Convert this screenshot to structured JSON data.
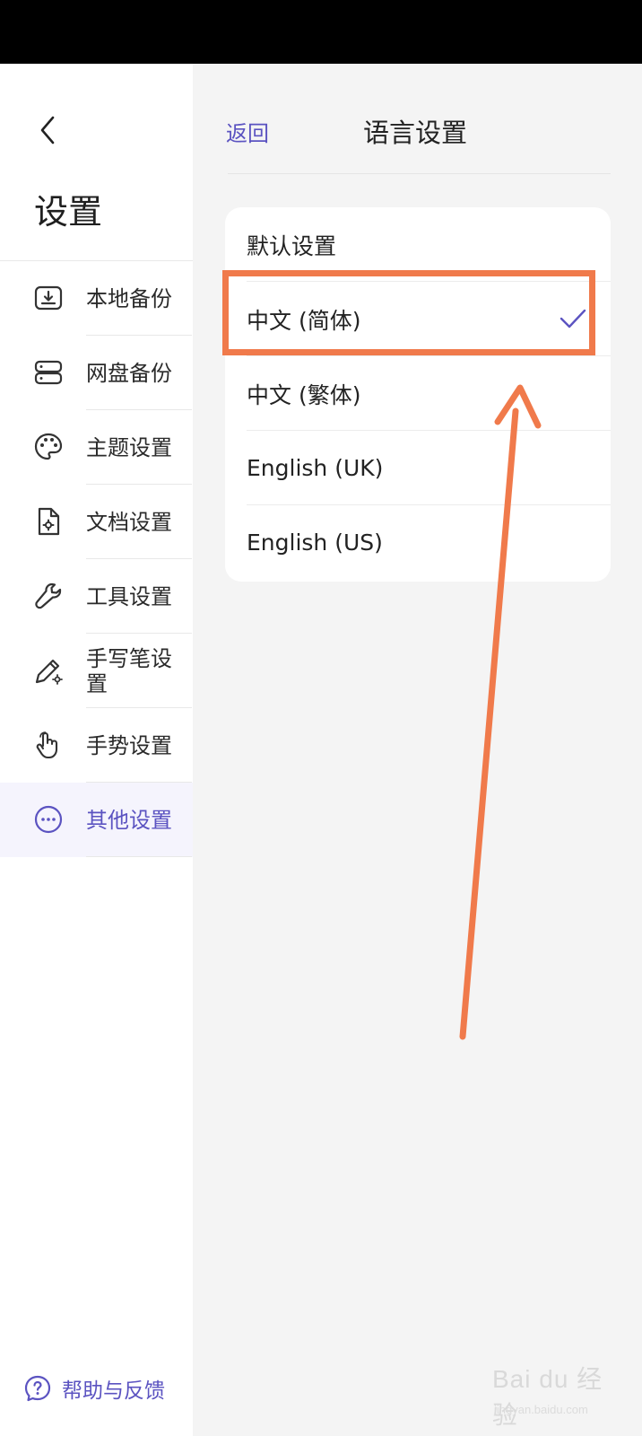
{
  "sidebar": {
    "title": "设置",
    "items": [
      {
        "label": "本地备份",
        "icon": "local-backup-icon"
      },
      {
        "label": "网盘备份",
        "icon": "cloud-drive-backup-icon"
      },
      {
        "label": "主题设置",
        "icon": "palette-icon"
      },
      {
        "label": "文档设置",
        "icon": "document-settings-icon"
      },
      {
        "label": "工具设置",
        "icon": "wrench-icon"
      },
      {
        "label": "手写笔设置",
        "icon": "pen-settings-icon"
      },
      {
        "label": "手势设置",
        "icon": "hand-gesture-icon"
      },
      {
        "label": "其他设置",
        "icon": "more-dots-icon",
        "active": true
      }
    ],
    "help_label": "帮助与反馈"
  },
  "header": {
    "return_label": "返回",
    "title": "语言设置"
  },
  "languages": {
    "options": [
      {
        "label": "默认设置"
      },
      {
        "label": "中文 (简体)",
        "selected": true
      },
      {
        "label": "中文 (繁体)"
      },
      {
        "label": "English (UK)"
      },
      {
        "label": "English (US)"
      }
    ]
  },
  "watermark": {
    "brand": "Bai du 经验",
    "url": "jingyan.baidu.com"
  },
  "colors": {
    "accent": "#5b53c1",
    "annotation": "#f07a4b",
    "sidebar_active_bg": "#f5f4fd",
    "page_bg": "#f4f4f4"
  }
}
